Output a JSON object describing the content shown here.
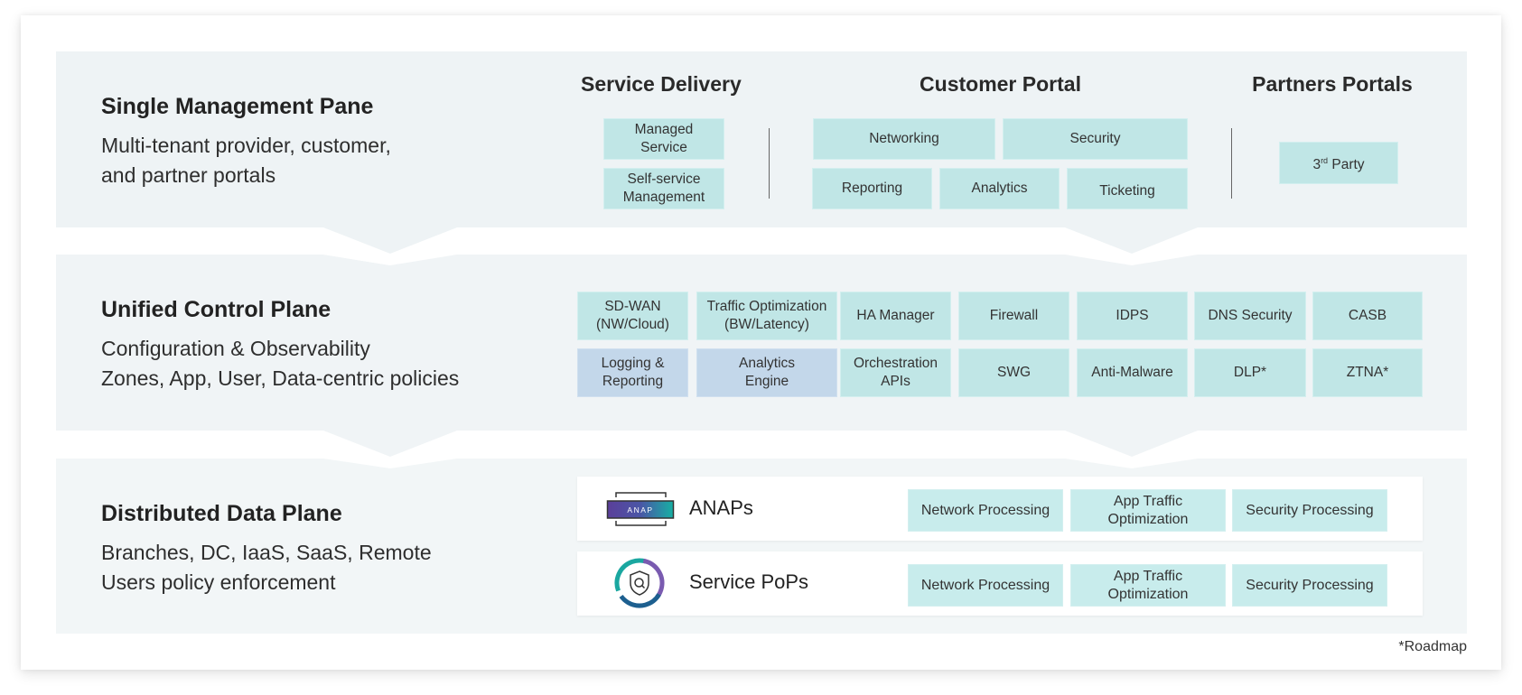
{
  "sections": {
    "management": {
      "title": "Single Management Pane",
      "body_line1": "Multi-tenant provider, customer,",
      "body_line2": "and partner portals",
      "columns": {
        "service_delivery": {
          "heading": "Service Delivery",
          "items": [
            "Managed Service",
            "Self-service Management"
          ]
        },
        "customer_portal": {
          "heading": "Customer Portal",
          "items": [
            "Networking",
            "Security",
            "Reporting",
            "Analytics",
            "Ticketing"
          ]
        },
        "partners_portals": {
          "heading": "Partners Portals",
          "item_prefix": "3",
          "item_superscript": "rd",
          "item_suffix": " Party"
        }
      }
    },
    "control": {
      "title": "Unified Control Plane",
      "body_line1": "Configuration & Observability",
      "body_line2": "Zones, App, User, Data-centric policies",
      "row1": [
        "SD-WAN\n(NW/Cloud)",
        "Traffic Optimization\n(BW/Latency)",
        "HA Manager",
        "Firewall",
        "IDPS",
        "DNS Security",
        "CASB"
      ],
      "row2": [
        "Logging &\nReporting",
        "Analytics\nEngine",
        "Orchestration\nAPIs",
        "SWG",
        "Anti-Malware",
        "DLP*",
        "ZTNA*"
      ],
      "highlight_color": "#c3d7ea",
      "default_color": "#c0e6e6"
    },
    "data": {
      "title": "Distributed Data Plane",
      "body_line1": "Branches, DC, IaaS, SaaS, Remote",
      "body_line2": "Users policy enforcement",
      "rows": [
        {
          "label": "ANAPs",
          "icon": "anap-appliance-icon",
          "icon_text": "ANAP",
          "processing": [
            "Network Processing",
            "App Traffic Optimization",
            "Security Processing"
          ]
        },
        {
          "label": "Service PoPs",
          "icon": "shield-search-icon",
          "processing": [
            "Network Processing",
            "App Traffic Optimization",
            "Security Processing"
          ]
        }
      ]
    }
  },
  "footnote": "*Roadmap",
  "colors": {
    "brand_purple": "#5b3f9a",
    "brand_teal": "#1aa7a0",
    "brand_blue": "#1d5f8f"
  }
}
